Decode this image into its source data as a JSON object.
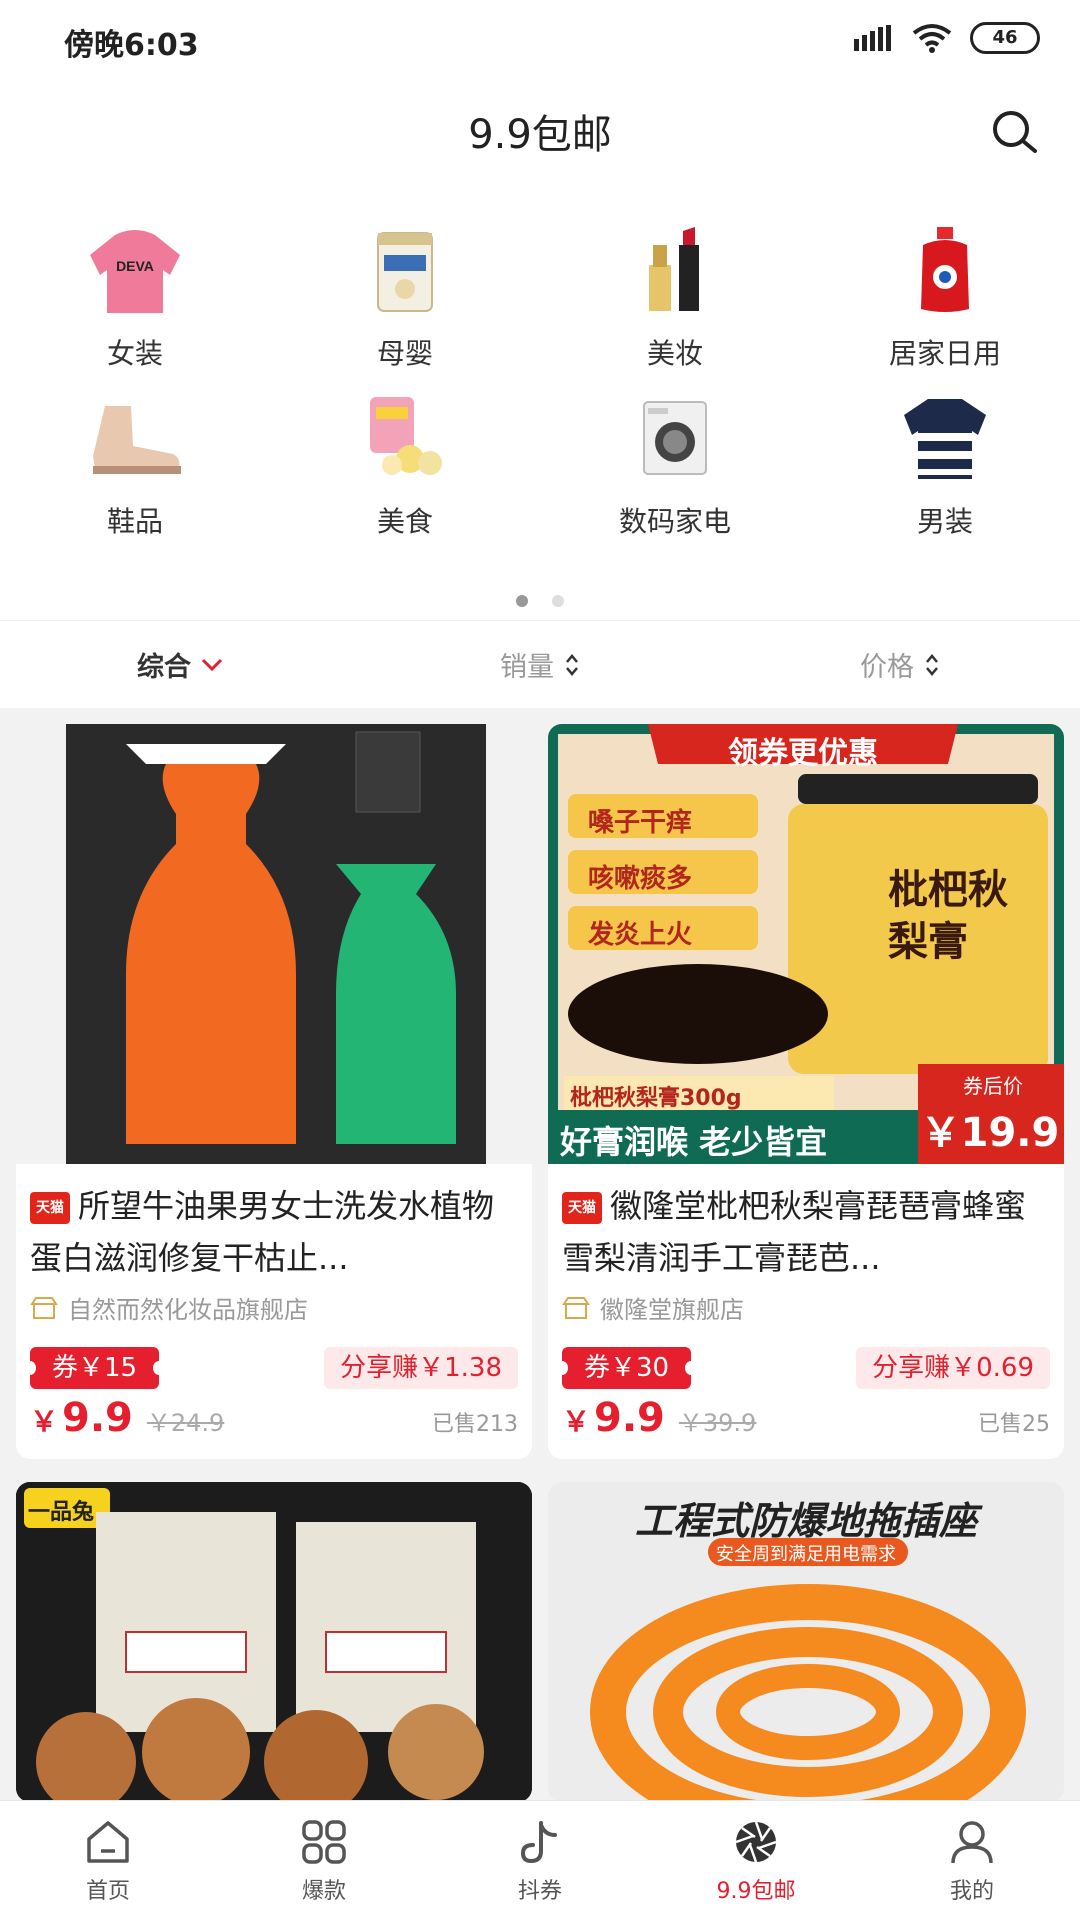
{
  "status_bar": {
    "time": "傍晚6:03",
    "battery": "46"
  },
  "header": {
    "title": "9.9包邮"
  },
  "categories": [
    {
      "label": "女装",
      "icon": "hoodie-icon"
    },
    {
      "label": "母婴",
      "icon": "milk-powder-icon"
    },
    {
      "label": "美妆",
      "icon": "lipstick-icon"
    },
    {
      "label": "居家日用",
      "icon": "detergent-icon"
    },
    {
      "label": "鞋品",
      "icon": "boot-icon"
    },
    {
      "label": "美食",
      "icon": "snack-icon"
    },
    {
      "label": "数码家电",
      "icon": "washing-machine-icon"
    },
    {
      "label": "男装",
      "icon": "sweater-icon"
    }
  ],
  "sort": {
    "comprehensive": "综合",
    "sales": "销量",
    "price": "价格"
  },
  "products": [
    {
      "platform": "天猫",
      "title": "所望牛油果男女士洗发水植物蛋白滋润修复干枯止...",
      "shop": "自然而然化妆品旗舰店",
      "coupon": "券￥15",
      "share": "分享赚￥1.38",
      "yen": "￥",
      "price": "9.9",
      "original": "￥24.9",
      "sold": "已售213"
    },
    {
      "platform": "天猫",
      "title": "徽隆堂枇杷秋梨膏琵琶膏蜂蜜雪梨清润手工膏琵芭...",
      "shop": "徽隆堂旗舰店",
      "coupon": "券￥30",
      "share": "分享赚￥0.69",
      "yen": "￥",
      "price": "9.9",
      "original": "￥39.9",
      "sold": "已售25",
      "banner": {
        "top": "领券更优惠",
        "tags": [
          "嗓子干痒",
          "咳嗽痰多",
          "发炎上火"
        ],
        "jar": "枇杷秋梨膏",
        "weight": "枇杷秋梨膏300g",
        "slogan": "好膏润喉 老少皆宜",
        "after_coupon": "券后价",
        "after_price": "￥19.9"
      }
    },
    {
      "banner_left": "一品兔"
    },
    {
      "banner_title": "工程式防爆地拖插座",
      "banner_sub": "安全周到满足用电需求"
    }
  ],
  "tabs": [
    {
      "label": "首页",
      "icon": "home-icon"
    },
    {
      "label": "爆款",
      "icon": "grid-icon"
    },
    {
      "label": "抖券",
      "icon": "douyin-icon"
    },
    {
      "label": "9.9包邮",
      "icon": "aperture-icon"
    },
    {
      "label": "我的",
      "icon": "profile-icon"
    }
  ],
  "colors": {
    "accent": "#e51f2e",
    "text": "#333333",
    "background": "#f2f2f2"
  }
}
